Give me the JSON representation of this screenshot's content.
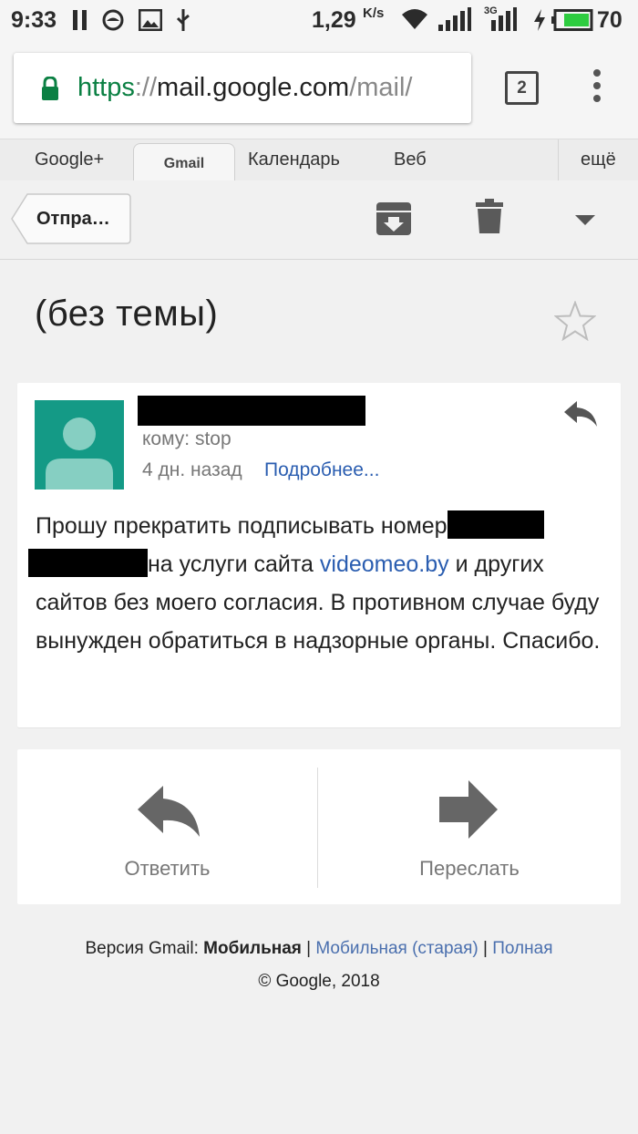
{
  "status_bar": {
    "time": "9:33",
    "net_speed": "1,29",
    "net_unit": "K/s",
    "network_type": "3G",
    "battery_level": "70"
  },
  "browser": {
    "url_scheme": "https",
    "url_separator": "://",
    "url_host": "mail.google.com",
    "url_path": "/mail/",
    "tab_count": "2"
  },
  "google_nav": {
    "tabs": [
      "Google+",
      "Gmail",
      "Календарь",
      "Веб"
    ],
    "more": "ещё"
  },
  "toolbar": {
    "back_label": "Отпра…"
  },
  "message": {
    "subject": "(без темы)",
    "to": "кому: stop",
    "date": "4 дн. назад",
    "details_link": "Подробнее...",
    "body_part1": "Прошу прекратить подписывать номер",
    "body_part2": "на услуги сайта ",
    "body_link": "videomeo.by",
    "body_part3": " и других сайтов без моего согласия. В противном случае буду вынужден обратиться в надзорные органы. Спасибо."
  },
  "actions": {
    "reply": "Ответить",
    "forward": "Переслать"
  },
  "footer": {
    "version_prefix": "Версия Gmail: ",
    "version_current": "Мобильная",
    "separator": " | ",
    "version_old": "Мобильная (старая)",
    "version_full": "Полная",
    "copyright": "© Google, 2018"
  },
  "colors": {
    "avatar_bg": "#149a86",
    "link": "#2a5db0",
    "secure_green": "#0b8043",
    "battery_green": "#2ecc40"
  }
}
